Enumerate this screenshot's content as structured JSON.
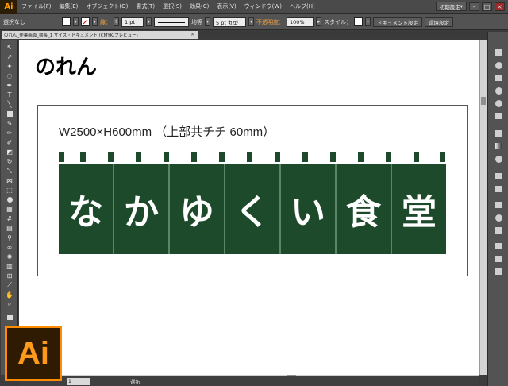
{
  "app": {
    "logo": "Ai"
  },
  "menu": [
    "ファイル(F)",
    "編集(E)",
    "オブジェクト(O)",
    "書式(T)",
    "選択(S)",
    "効果(C)",
    "表示(V)",
    "ウィンドウ(W)",
    "ヘルプ(H)"
  ],
  "workspace": {
    "label": "初期設定"
  },
  "control_bar": {
    "selection": "選択なし",
    "stroke_label": "線：",
    "stroke_weight": "1 pt",
    "stroke_profile": "均等",
    "brush": "5 pt 丸型",
    "opacity_label": "不透明度：",
    "opacity_value": "100%",
    "style_label": "スタイル：",
    "doc_setup_button": "ドキュメント設定",
    "prefs_button": "環境設定"
  },
  "document_tab": {
    "title": "のれん_作業画面_横長_1 サイズ・ドキュメント (CMYK/プレビュー)",
    "close": "×"
  },
  "artwork": {
    "title": "のれん",
    "dimensions": "W2500×H600mm （上部共チチ 60mm）",
    "panels": [
      "な",
      "か",
      "ゆ",
      "く",
      "い",
      "食",
      "堂"
    ],
    "fabric_color": "#1d4a2a",
    "text_color": "#ffffff"
  },
  "status_bar": {
    "zoom": "1",
    "tool": "選択"
  },
  "badge": {
    "text": "Ai",
    "accent": "#ff8c00"
  }
}
